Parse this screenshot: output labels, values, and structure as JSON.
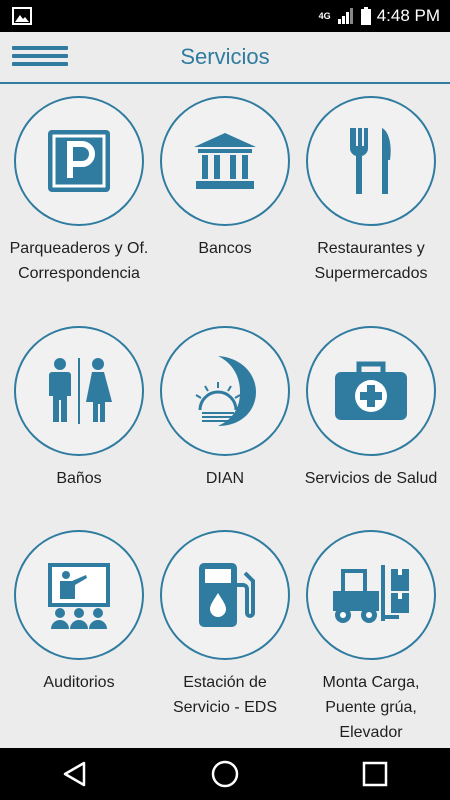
{
  "status_bar": {
    "network": "4G",
    "time": "4:48 PM"
  },
  "header": {
    "title": "Servicios"
  },
  "services": [
    {
      "label": "Parqueaderos y Of. Correspondencia",
      "icon": "parking-icon"
    },
    {
      "label": "Bancos",
      "icon": "bank-icon"
    },
    {
      "label": "Restaurantes y Supermercados",
      "icon": "fork-knife-icon"
    },
    {
      "label": "Baños",
      "icon": "restroom-icon"
    },
    {
      "label": "DIAN",
      "icon": "dian-logo-icon"
    },
    {
      "label": "Servicios de Salud",
      "icon": "first-aid-kit-icon"
    },
    {
      "label": "Auditorios",
      "icon": "presentation-icon"
    },
    {
      "label": "Estación de Servicio - EDS",
      "icon": "fuel-pump-icon"
    },
    {
      "label": "Monta Carga, Puente grúa, Elevador",
      "icon": "forklift-icon"
    }
  ],
  "colors": {
    "accent": "#2f7ca0",
    "background": "#ececec"
  }
}
